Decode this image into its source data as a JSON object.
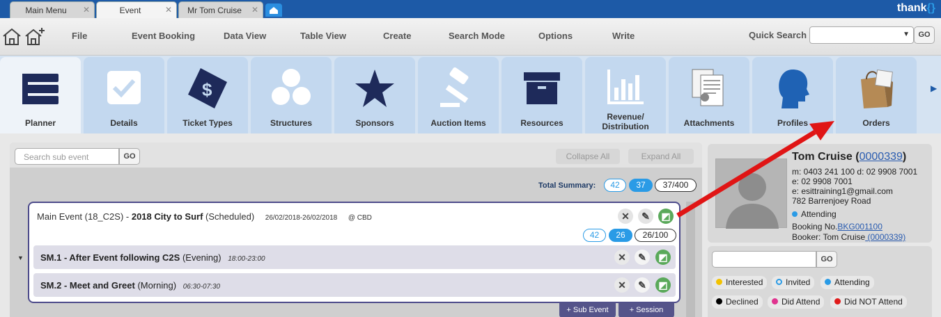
{
  "tabs": [
    {
      "label": "Main Menu",
      "close": "✕"
    },
    {
      "label": "Event",
      "close": "✕"
    },
    {
      "label": "Mr Tom Cruise",
      "close": "✕"
    }
  ],
  "brand": "thank",
  "menu": [
    "File",
    "Event Booking",
    "Data View",
    "Table View",
    "Create",
    "Search Mode",
    "Options",
    "Write"
  ],
  "quick_search": {
    "label": "Quick Search",
    "go": "GO"
  },
  "ribbon": [
    {
      "label": "Planner",
      "icon": "planner-icon"
    },
    {
      "label": "Details",
      "icon": "checkbox-icon"
    },
    {
      "label": "Ticket Types",
      "icon": "ticket-icon"
    },
    {
      "label": "Structures",
      "icon": "circles-icon"
    },
    {
      "label": "Sponsors",
      "icon": "star-icon"
    },
    {
      "label": "Auction Items",
      "icon": "gavel-icon"
    },
    {
      "label": "Resources",
      "icon": "archive-box-icon"
    },
    {
      "label": "Revenue/",
      "label2": "Distribution",
      "icon": "bar-chart-icon"
    },
    {
      "label": "Attachments",
      "icon": "documents-icon"
    },
    {
      "label": "Profiles",
      "icon": "head-profile-icon"
    },
    {
      "label": "Orders",
      "icon": "shopping-bag-icon"
    }
  ],
  "planner": {
    "search_placeholder": "Search sub event",
    "go": "GO",
    "collapse_all": "Collapse All",
    "expand_all": "Expand All",
    "total_label": "Total Summary:",
    "total": {
      "a": "42",
      "b": "37",
      "c": "37/400"
    },
    "main_event": {
      "prefix": "Main Event (18_C2S) - ",
      "name": "2018 City to Surf",
      "status": " (Scheduled)",
      "dates": "26/02/2018-26/02/2018",
      "location": "@ CBD",
      "counts": {
        "a": "42",
        "b": "26",
        "c": "26/100"
      }
    },
    "sub_events": [
      {
        "code": "SM.1 - ",
        "name": "After Event following C2S",
        "period": " (Evening)",
        "time": "18:00-23:00"
      },
      {
        "code": "SM.2 - ",
        "name": "Meet and Greet",
        "period": " (Morning)",
        "time": "06:30-07:30"
      }
    ],
    "add_sub_event": "+ Sub Event",
    "add_session": "+ Session"
  },
  "profile": {
    "name": "Tom Cruise",
    "id": "0000339",
    "mobile_line": "m: 0403 241 100  d: 02 9908 7001",
    "e1": "e: 02 9908 7001",
    "email": "e: esittraining1@gmail.com",
    "address": "782 Barrenjoey Road",
    "status": "Attending",
    "booking_label": "Booking No.",
    "booking_no": "BKG001100",
    "booker_label": "Booker: Tom Cruise",
    "booker_id": " (0000339)"
  },
  "filters": {
    "go": "GO",
    "chips": [
      {
        "label": "Interested",
        "color": "#f2c200"
      },
      {
        "label": "Invited",
        "color": "#2a9be6"
      },
      {
        "label": "Attending",
        "color": "#2a9be6"
      },
      {
        "label": "Declined",
        "color": "#000000"
      },
      {
        "label": "Did Attend",
        "color": "#e0338f"
      },
      {
        "label": "Did NOT Attend",
        "color": "#e01b1b"
      }
    ]
  }
}
